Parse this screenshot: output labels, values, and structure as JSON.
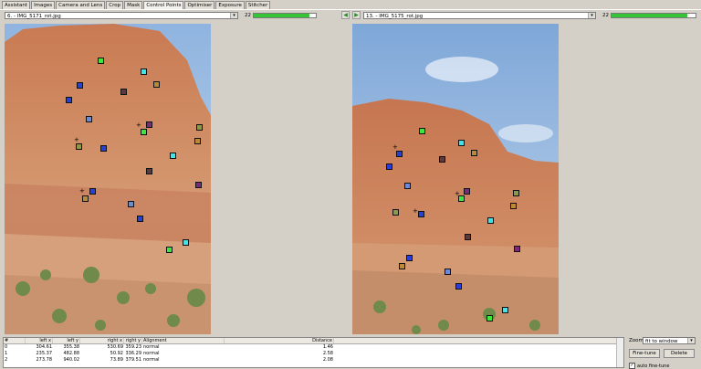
{
  "tabs": [
    {
      "label": "Assistant",
      "active": false
    },
    {
      "label": "Images",
      "active": false
    },
    {
      "label": "Camera and Lens",
      "active": false
    },
    {
      "label": "Crop",
      "active": false
    },
    {
      "label": "Mask",
      "active": false
    },
    {
      "label": "Control Points",
      "active": true
    },
    {
      "label": "Optimiser",
      "active": false
    },
    {
      "label": "Exposure",
      "active": false
    },
    {
      "label": "Stitcher",
      "active": false
    }
  ],
  "left_image": {
    "selected": "6. - IMG_5171_rot.jpg",
    "cp_count": "22",
    "progress": 0.9
  },
  "right_image": {
    "selected": "13. - IMG_5175_rot.jpg",
    "cp_count": "22",
    "progress": 0.9
  },
  "table": {
    "columns": [
      "#",
      "left x",
      "left y",
      "right x",
      "right y",
      "Alignment",
      "Distance"
    ],
    "rows": [
      [
        "0",
        "304.61",
        "355.38",
        "530.69",
        "359.23",
        "normal",
        "1.46"
      ],
      [
        "1",
        "235.37",
        "482.88",
        "50.92",
        "336.29",
        "normal",
        "2.58"
      ],
      [
        "2",
        "273.78",
        "940.02",
        "73.89",
        "379.51",
        "normal",
        "2.08"
      ]
    ]
  },
  "zoom": {
    "label": "Zoom:",
    "value": "fit to window"
  },
  "buttons": {
    "fine_tune": "Fine-tune",
    "delete": "Delete"
  },
  "auto_fine_tune": {
    "label": "auto fine-tune",
    "checked": true
  }
}
